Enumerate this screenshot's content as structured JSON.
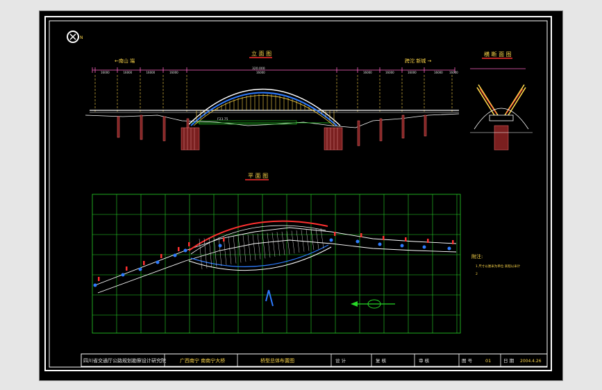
{
  "views": {
    "elevation": {
      "title": "立 面 图",
      "left_label": "←南山 端",
      "right_label": "跨沱 新城 →",
      "span_label": "320.000",
      "annotation": "F23.75"
    },
    "section": {
      "title": "横 断 面 图"
    },
    "plan": {
      "title": "平 面 图"
    }
  },
  "elevation_dims": [
    "16000",
    "16000",
    "16000",
    "16000",
    "16000",
    "160000",
    "16000",
    "16000",
    "16000",
    "16000",
    "16000"
  ],
  "notes": {
    "title": "附注:",
    "lines": [
      "1  尺寸以厘米为单位  高程以米计",
      "2"
    ]
  },
  "title_block": {
    "org": "四川省交通厅公路规划勘察设计研究院",
    "project": "广西南宁  南南宁大桥",
    "drawing": "桥型总体布置图",
    "cells": [
      {
        "label": "设 计",
        "value": ""
      },
      {
        "label": "复 核",
        "value": ""
      },
      {
        "label": "审 核",
        "value": ""
      },
      {
        "label": "图 号",
        "value": "01"
      },
      {
        "label": "日 期",
        "value": "2004.4.26"
      }
    ]
  },
  "colors": {
    "background": "#000000",
    "grid": "#27d827",
    "arch": "#ffd84a",
    "accent": "#ff3030",
    "dim": "#ff66c4",
    "outline": "#ffffff"
  }
}
